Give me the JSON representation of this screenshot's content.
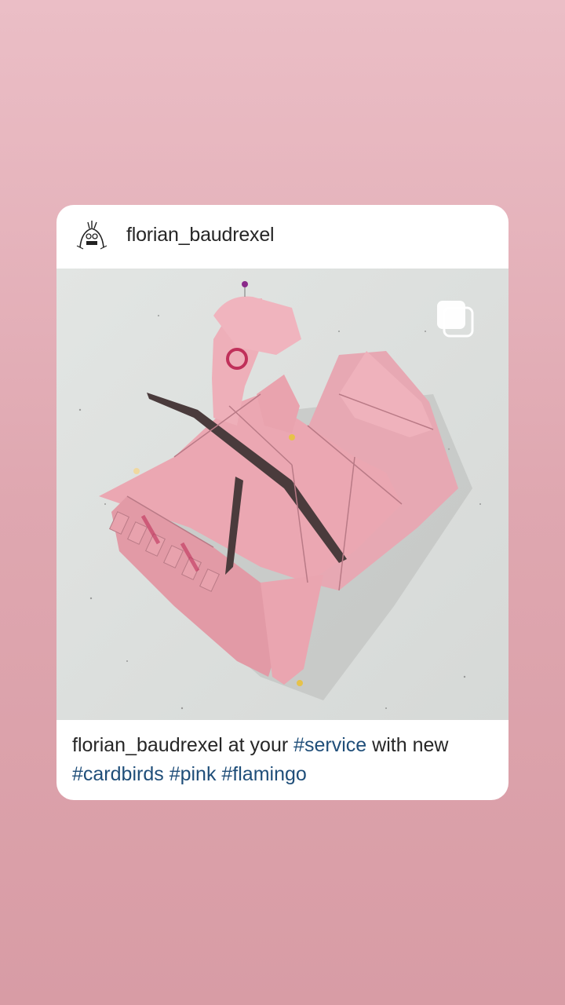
{
  "post": {
    "username": "florian_baudrexel",
    "avatar_icon": "cartoon-face-avatar",
    "media_icon": "multiple-photos-icon",
    "caption": {
      "username": "florian_baudrexel",
      "text_before": " at your ",
      "tag_service": "#service",
      "text_after": " with new ",
      "tag_cardbirds": "#cardbirds",
      "tag_pink": "#pink",
      "tag_flamingo": "#flamingo"
    }
  },
  "colors": {
    "background_top": "#ebbec6",
    "background_bottom": "#d89ca5",
    "card": "#ffffff",
    "hashtag": "#1f4e79",
    "text": "#262626"
  }
}
